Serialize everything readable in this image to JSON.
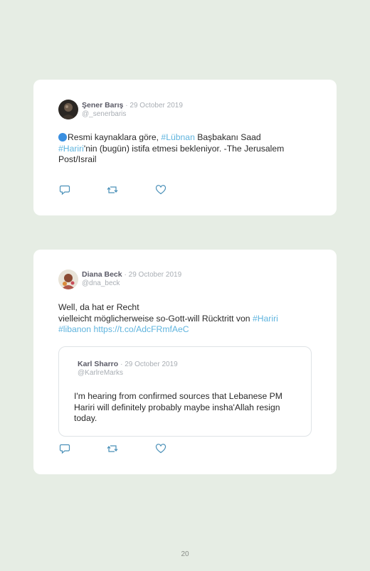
{
  "tweets": [
    {
      "name": "Şener Barış",
      "date": "· 29 October 2019",
      "handle": "@_senerbaris",
      "text": {
        "part1": "Resmi kaynaklara göre, ",
        "hashtag1": "#Lübnan",
        "part2": " Başbakanı Saad ",
        "hashtag2": "#Hariri",
        "part3": "'nin (bugün) istifa etmesi bekleniyor. -The Jerusalem Post/Israil"
      }
    },
    {
      "name": "Diana Beck",
      "date": "· 29 October 2019",
      "handle": "@dna_beck",
      "text": {
        "line1": "Well, da hat er Recht",
        "line2": "vielleicht möglicherweise so-Gott-will Rücktritt von ",
        "hashtag1": "#Hariri",
        "hashtag2": "#libanon",
        "url": "https://t.co/AdcFRmfAeC"
      },
      "quote": {
        "name": "Karl Sharro",
        "date": "· 29 October 2019",
        "handle": "@KarlreMarks",
        "text": "I'm hearing from confirmed sources that Lebanese PM Hariri will definitely probably maybe insha'Allah resign today."
      }
    }
  ],
  "page_number": "20",
  "colors": {
    "background": "#e6ede4",
    "link": "#5fb4de",
    "icon": "#4a90b8"
  }
}
